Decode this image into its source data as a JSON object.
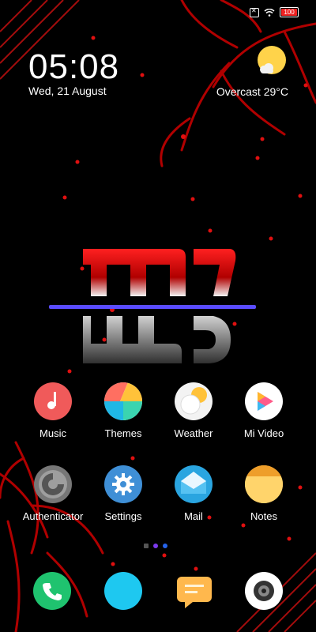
{
  "status_bar": {
    "battery": "100"
  },
  "clock": {
    "time": "05:08",
    "date": "Wed, 21 August"
  },
  "weather": {
    "text": "Overcast  29°C"
  },
  "apps": [
    {
      "label": "Music"
    },
    {
      "label": "Themes"
    },
    {
      "label": "Weather"
    },
    {
      "label": "Mi Video"
    },
    {
      "label": "Authenticator"
    },
    {
      "label": "Settings"
    },
    {
      "label": "Mail"
    },
    {
      "label": "Notes"
    }
  ],
  "dock": [
    "phone-icon",
    "browser-icon",
    "messages-icon",
    "camera-icon"
  ],
  "colors": {
    "accent_red": "#e01010",
    "music": "#f05a5a",
    "phone": "#1fc36f",
    "browser": "#1ec8f0",
    "messages": "#ffb84d",
    "notes": "#f6b94a",
    "settings": "#3f8fd6"
  }
}
